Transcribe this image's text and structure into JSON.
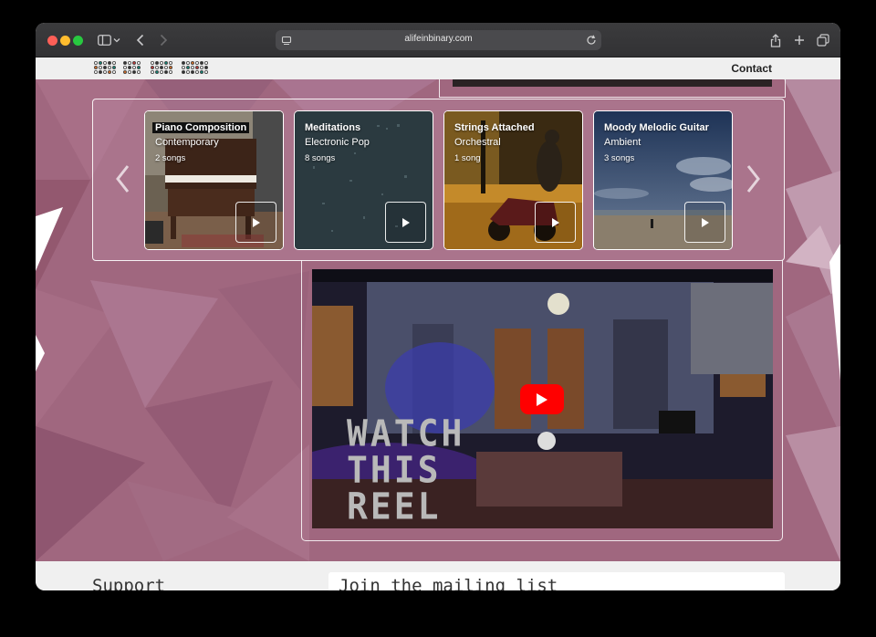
{
  "browser": {
    "url": "alifeinbinary.com",
    "icons": [
      "sidebar-icon",
      "chevron-down-icon",
      "back-icon",
      "forward-icon",
      "site-settings-icon",
      "reload-icon",
      "share-icon",
      "new-tab-icon",
      "tabs-overview-icon"
    ]
  },
  "header": {
    "contact_label": "Contact"
  },
  "playlists": [
    {
      "title": "Piano Composition",
      "genre": "Contemporary",
      "count": "2 songs"
    },
    {
      "title": "Meditations",
      "genre": "Electronic Pop",
      "count": "8 songs"
    },
    {
      "title": "Strings Attached",
      "genre": "Orchestral",
      "count": "1 song"
    },
    {
      "title": "Moody Melodic Guitar",
      "genre": "Ambient",
      "count": "3 songs"
    }
  ],
  "video": {
    "overlay_lines": [
      "WATCH",
      "THIS",
      "REEL"
    ]
  },
  "footer": {
    "support_heading": "Support",
    "mailing_heading": "Join the mailing list"
  },
  "colors": {
    "hero_background": "#a0677f",
    "youtube_red": "#ff0000"
  }
}
